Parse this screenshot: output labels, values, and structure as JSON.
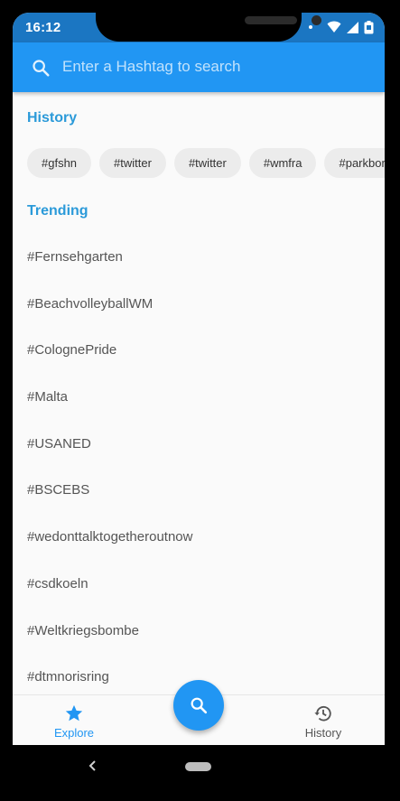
{
  "status_bar": {
    "time": "16:12"
  },
  "search": {
    "placeholder": "Enter a Hashtag to search"
  },
  "history": {
    "title": "History",
    "chips": [
      "#gfshn",
      "#twitter",
      "#twitter",
      "#wmfra",
      "#parkbom"
    ]
  },
  "trending": {
    "title": "Trending",
    "items": [
      "#Fernsehgarten",
      "#BeachvolleyballWM",
      "#ColognePride",
      "#Malta",
      "#USANED",
      "#BSCEBS",
      "#wedonttalktogetheroutnow",
      "#csdkoeln",
      "#Weltkriegsbombe",
      "#dtmnorisring"
    ]
  },
  "bottom_nav": {
    "explore_label": "Explore",
    "history_label": "History"
  },
  "colors": {
    "primary": "#2196f3",
    "status_bar": "#1b76c2",
    "section_title": "#2b9ad9"
  },
  "icons": {
    "search": "search-icon",
    "explore": "star-icon",
    "history": "history-icon",
    "fab": "search-icon",
    "system_back": "back-chevron-icon"
  }
}
